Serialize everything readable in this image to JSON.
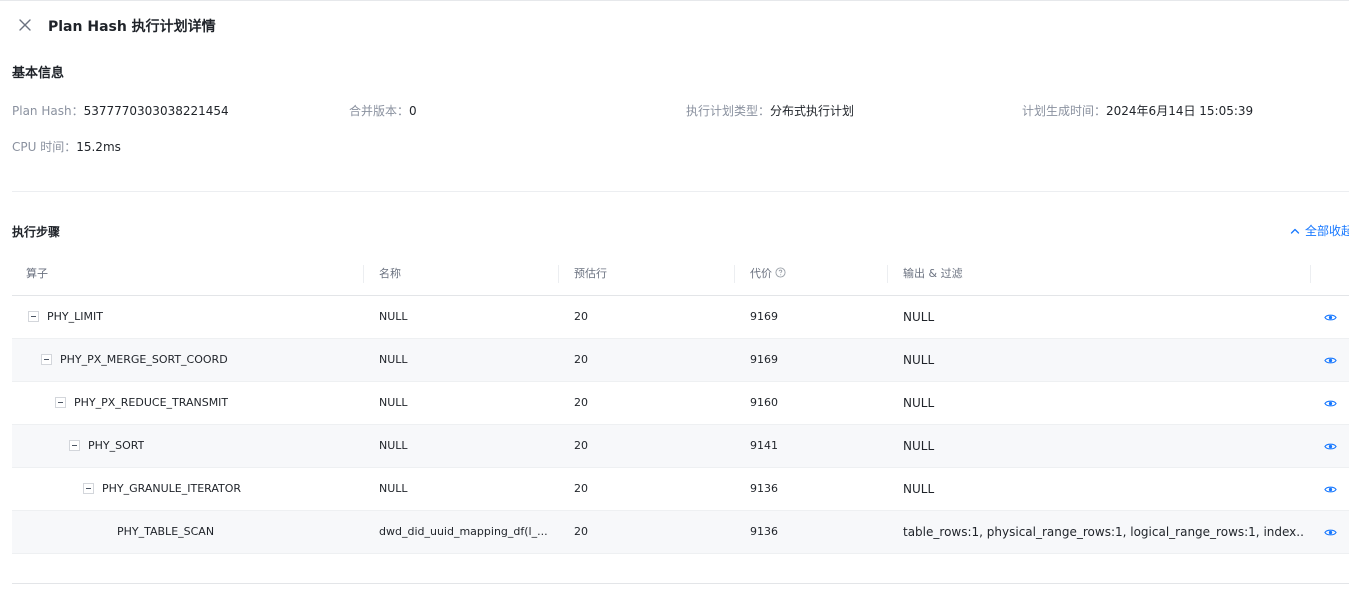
{
  "drawer": {
    "title": "Plan Hash 执行计划详情"
  },
  "basic_info": {
    "title": "基本信息",
    "fields": [
      {
        "label": "Plan Hash：",
        "value": "5377770303038221454"
      },
      {
        "label": "合并版本：",
        "value": "0"
      },
      {
        "label": "执行计划类型：",
        "value": "分布式执行计划"
      },
      {
        "label": "计划生成时间：",
        "value": "2024年6月14日 15:05:39"
      },
      {
        "label": "CPU 时间：",
        "value": "15.2ms"
      }
    ]
  },
  "steps": {
    "title": "执行步骤",
    "collapse_all_label": "全部收起",
    "columns": [
      "算子",
      "名称",
      "预估行",
      "代价",
      "输出 & 过滤"
    ],
    "rows": [
      {
        "operator": "PHY_LIMIT",
        "name": "NULL",
        "est_rows": "20",
        "cost": "9169",
        "output": "NULL",
        "level": 0,
        "collapsible": true
      },
      {
        "operator": "PHY_PX_MERGE_SORT_COORD",
        "name": "NULL",
        "est_rows": "20",
        "cost": "9169",
        "output": "NULL",
        "level": 1,
        "collapsible": true
      },
      {
        "operator": "PHY_PX_REDUCE_TRANSMIT",
        "name": "NULL",
        "est_rows": "20",
        "cost": "9160",
        "output": "NULL",
        "level": 2,
        "collapsible": true
      },
      {
        "operator": "PHY_SORT",
        "name": "NULL",
        "est_rows": "20",
        "cost": "9141",
        "output": "NULL",
        "level": 3,
        "collapsible": true
      },
      {
        "operator": "PHY_GRANULE_ITERATOR",
        "name": "NULL",
        "est_rows": "20",
        "cost": "9136",
        "output": "NULL",
        "level": 4,
        "collapsible": true
      },
      {
        "operator": "PHY_TABLE_SCAN",
        "name": "dwd_did_uuid_mapping_df(l_...",
        "est_rows": "20",
        "cost": "9136",
        "output": "table_rows:1, physical_range_rows:1, logical_range_rows:1, index...",
        "level": 5,
        "collapsible": false
      }
    ]
  },
  "colors": {
    "accent": "#1677ff",
    "row_alt_bg": "#f7f8fa",
    "label_gray": "#8a919f"
  },
  "icons": {
    "close": "close-icon",
    "collapse": "chevron-up-icon",
    "help": "question-circle-icon",
    "view": "eye-icon",
    "row_toggle": "minus-square-icon"
  }
}
